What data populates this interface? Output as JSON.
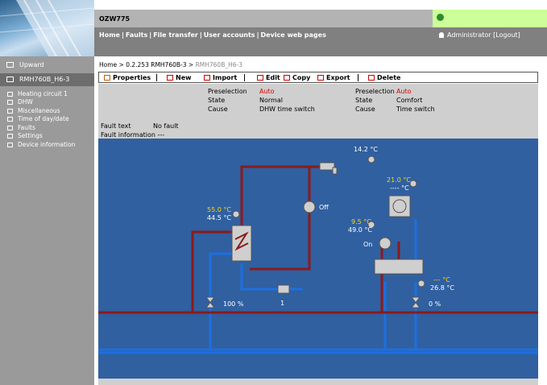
{
  "header": {
    "title": "OZW775",
    "nav": [
      "Home",
      "Faults",
      "File transfer",
      "User accounts",
      "Device web pages"
    ],
    "user": "Administrator",
    "logout": "[Logout]"
  },
  "sidebar": {
    "upward": "Upward",
    "selected": "RMH760B_H6-3",
    "items": [
      "Heating circuit 1",
      "DHW",
      "Miscellaneous",
      "Time of day/date",
      "Faults",
      "Settings",
      "Device information"
    ]
  },
  "breadcrumb": {
    "home": "Home",
    "parent": "0.2.253 RMH760B-3",
    "current": "RMH760B_H6-3"
  },
  "toolbar": {
    "properties": "Properties",
    "new": "New",
    "import": "Import",
    "edit": "Edit",
    "copy": "Copy",
    "export": "Export",
    "delete": "Delete"
  },
  "status": {
    "left": {
      "preselection_label": "Preselection",
      "preselection_value": "Auto",
      "state_label": "State",
      "state_value": "Normal",
      "cause_label": "Cause",
      "cause_value": "DHW time switch"
    },
    "right": {
      "preselection_label": "Preselection",
      "preselection_value": "Auto",
      "state_label": "State",
      "state_value": "Comfort",
      "cause_label": "Cause",
      "cause_value": "Time switch"
    },
    "fault_text_label": "Fault text",
    "fault_text_value": "No fault",
    "fault_info": "Fault information ---"
  },
  "plant": {
    "outdoor_temp": "14.2 °C",
    "room_setpoint": "21.0 °C",
    "room_actual": "---- °C",
    "dhw_setpoint": "55.0 °C",
    "dhw_actual": "44.5 °C",
    "dhw_pump_state": "Off",
    "flow_setpoint": "9.5 °C",
    "flow_actual": "49.0 °C",
    "hc_pump_state": "On",
    "return_setpoint": "--- °C",
    "return_actual": "26.8 °C",
    "dhw_valve_pos": "100 %",
    "hc_valve_pos": "0 %",
    "stage": "1"
  },
  "colors": {
    "flow_pipe": "#8b1a1a",
    "return_pipe": "#1e6fe0",
    "plant_bg": "#3060a0",
    "setpoint_text": "#ffd700"
  }
}
